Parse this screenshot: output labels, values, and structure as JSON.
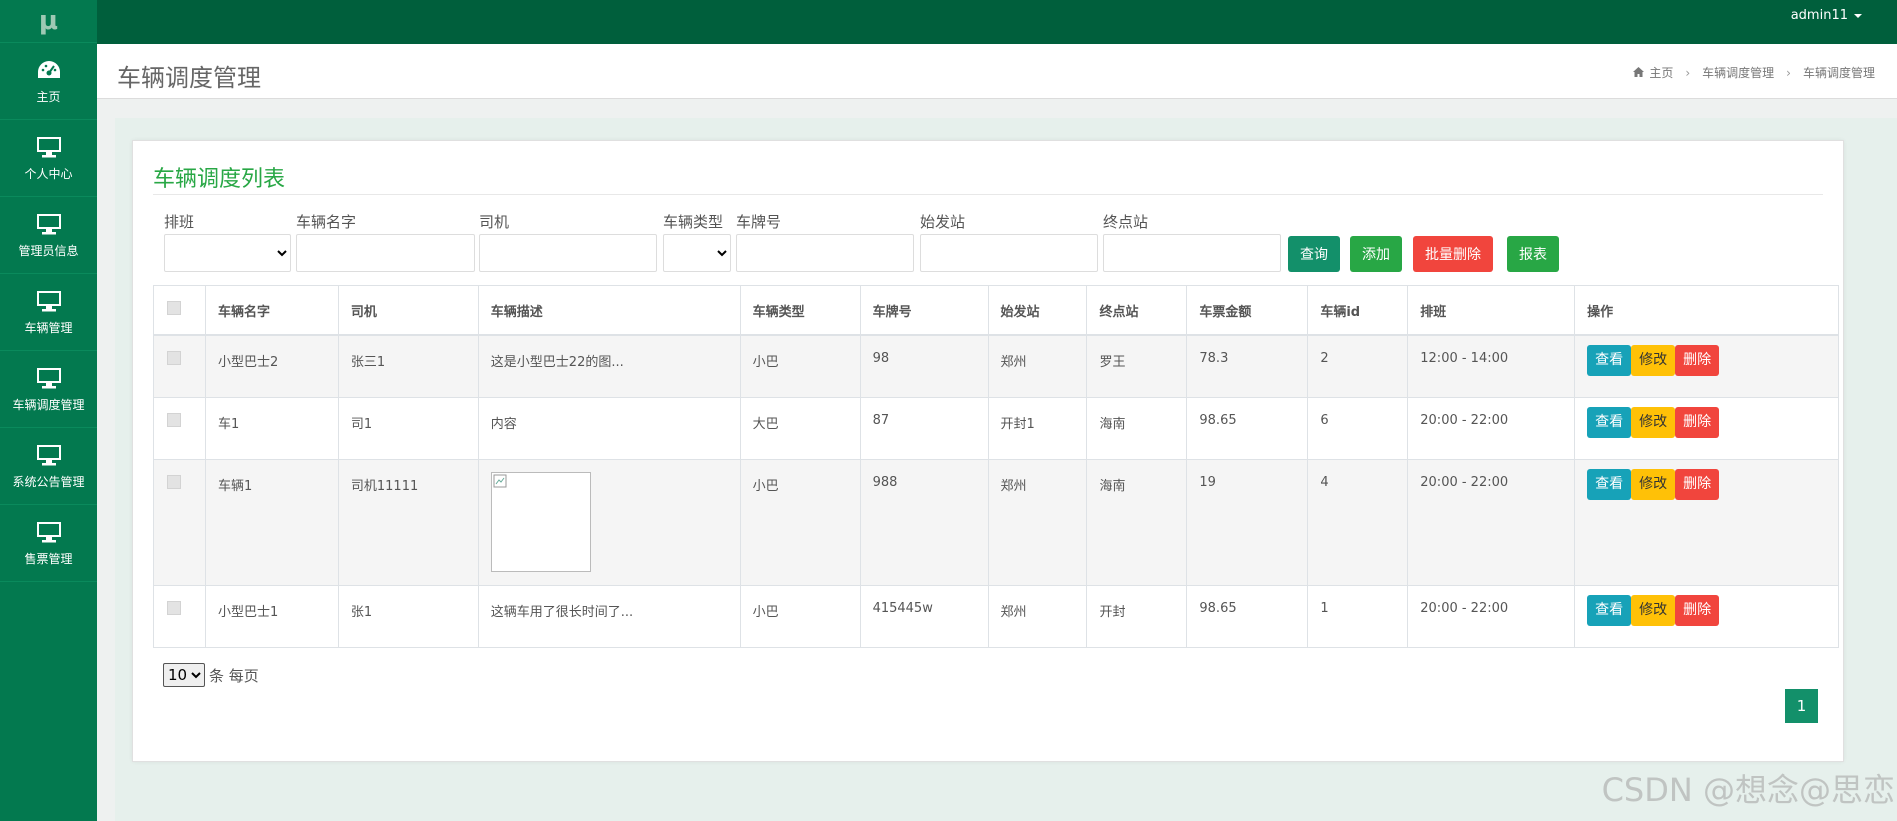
{
  "logo": "μ",
  "sidebar": {
    "items": [
      {
        "label": "主页",
        "icon": "dashboard-icon"
      },
      {
        "label": "个人中心",
        "icon": "monitor-icon"
      },
      {
        "label": "管理员信息",
        "icon": "monitor-icon"
      },
      {
        "label": "车辆管理",
        "icon": "monitor-icon"
      },
      {
        "label": "车辆调度管理",
        "icon": "monitor-icon"
      },
      {
        "label": "系统公告管理",
        "icon": "monitor-icon"
      },
      {
        "label": "售票管理",
        "icon": "monitor-icon"
      }
    ]
  },
  "topbar": {
    "user": "admin11"
  },
  "header": {
    "title": "车辆调度管理",
    "breadcrumb": [
      "主页",
      "车辆调度管理",
      "车辆调度管理"
    ]
  },
  "card": {
    "title": "车辆调度列表"
  },
  "filters": {
    "schedule": {
      "label": "排班",
      "value": ""
    },
    "vehicle_name": {
      "label": "车辆名字",
      "value": ""
    },
    "driver": {
      "label": "司机",
      "value": ""
    },
    "vehicle_type": {
      "label": "车辆类型",
      "value": ""
    },
    "plate": {
      "label": "车牌号",
      "value": ""
    },
    "start_station": {
      "label": "始发站",
      "value": ""
    },
    "end_station": {
      "label": "终点站",
      "value": ""
    }
  },
  "buttons": {
    "query": "查询",
    "add": "添加",
    "batch_delete": "批量删除",
    "report": "报表"
  },
  "table": {
    "headers": [
      "车辆名字",
      "司机",
      "车辆描述",
      "车辆类型",
      "车牌号",
      "始发站",
      "终点站",
      "车票金额",
      "车辆id",
      "排班",
      "操作"
    ],
    "rows": [
      {
        "name": "小型巴士2",
        "driver": "张三1",
        "desc": "这是小型巴士22的图...",
        "type": "小巴",
        "plate": "98",
        "start": "郑州",
        "end": "罗王",
        "price": "78.3",
        "vid": "2",
        "schedule": "12:00 - 14:00"
      },
      {
        "name": "车1",
        "driver": "司1",
        "desc": "内容",
        "type": "大巴",
        "plate": "87",
        "start": "开封1",
        "end": "海南",
        "price": "98.65",
        "vid": "6",
        "schedule": "20:00 - 22:00"
      },
      {
        "name": "车辆1",
        "driver": "司机11111",
        "desc": "",
        "type": "小巴",
        "plate": "988",
        "start": "郑州",
        "end": "海南",
        "price": "19",
        "vid": "4",
        "schedule": "20:00 - 22:00"
      },
      {
        "name": "小型巴士1",
        "driver": "张1",
        "desc": "这辆车用了很长时间了...",
        "type": "小巴",
        "plate": "415445w",
        "start": "郑州",
        "end": "开封",
        "price": "98.65",
        "vid": "1",
        "schedule": "20:00 - 22:00"
      }
    ],
    "actions": {
      "view": "查看",
      "edit": "修改",
      "delete": "删除"
    }
  },
  "pagination": {
    "page_size": "10",
    "page_size_suffix": "条 每页",
    "current_page": "1"
  },
  "watermark": "CSDN @想念@思恋",
  "colors": {
    "sidebar": "#03794f",
    "topbar": "#005f3c",
    "accent": "#28a745"
  }
}
